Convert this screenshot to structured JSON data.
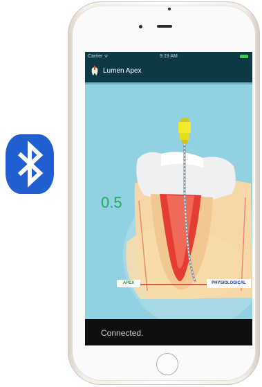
{
  "status_bar": {
    "carrier": "Carrier ᯤ",
    "time": "9:19 AM"
  },
  "app": {
    "title": "Lumen Apex"
  },
  "measurement": {
    "reading": "0.5"
  },
  "labels": {
    "apex": "APEX",
    "physiological": "PHYSIOLOGICAL"
  },
  "footer": {
    "status": "Connected."
  },
  "icons": {
    "bluetooth": "bluetooth-icon",
    "app_logo": "tooth-logo-icon",
    "battery": "battery-icon"
  },
  "colors": {
    "nav_bg": "#0c3944",
    "screen_bg": "#92d1e1",
    "reading": "#26a85f",
    "bluetooth": "#1f5fcf",
    "footer_bg": "#0f0f0f"
  }
}
